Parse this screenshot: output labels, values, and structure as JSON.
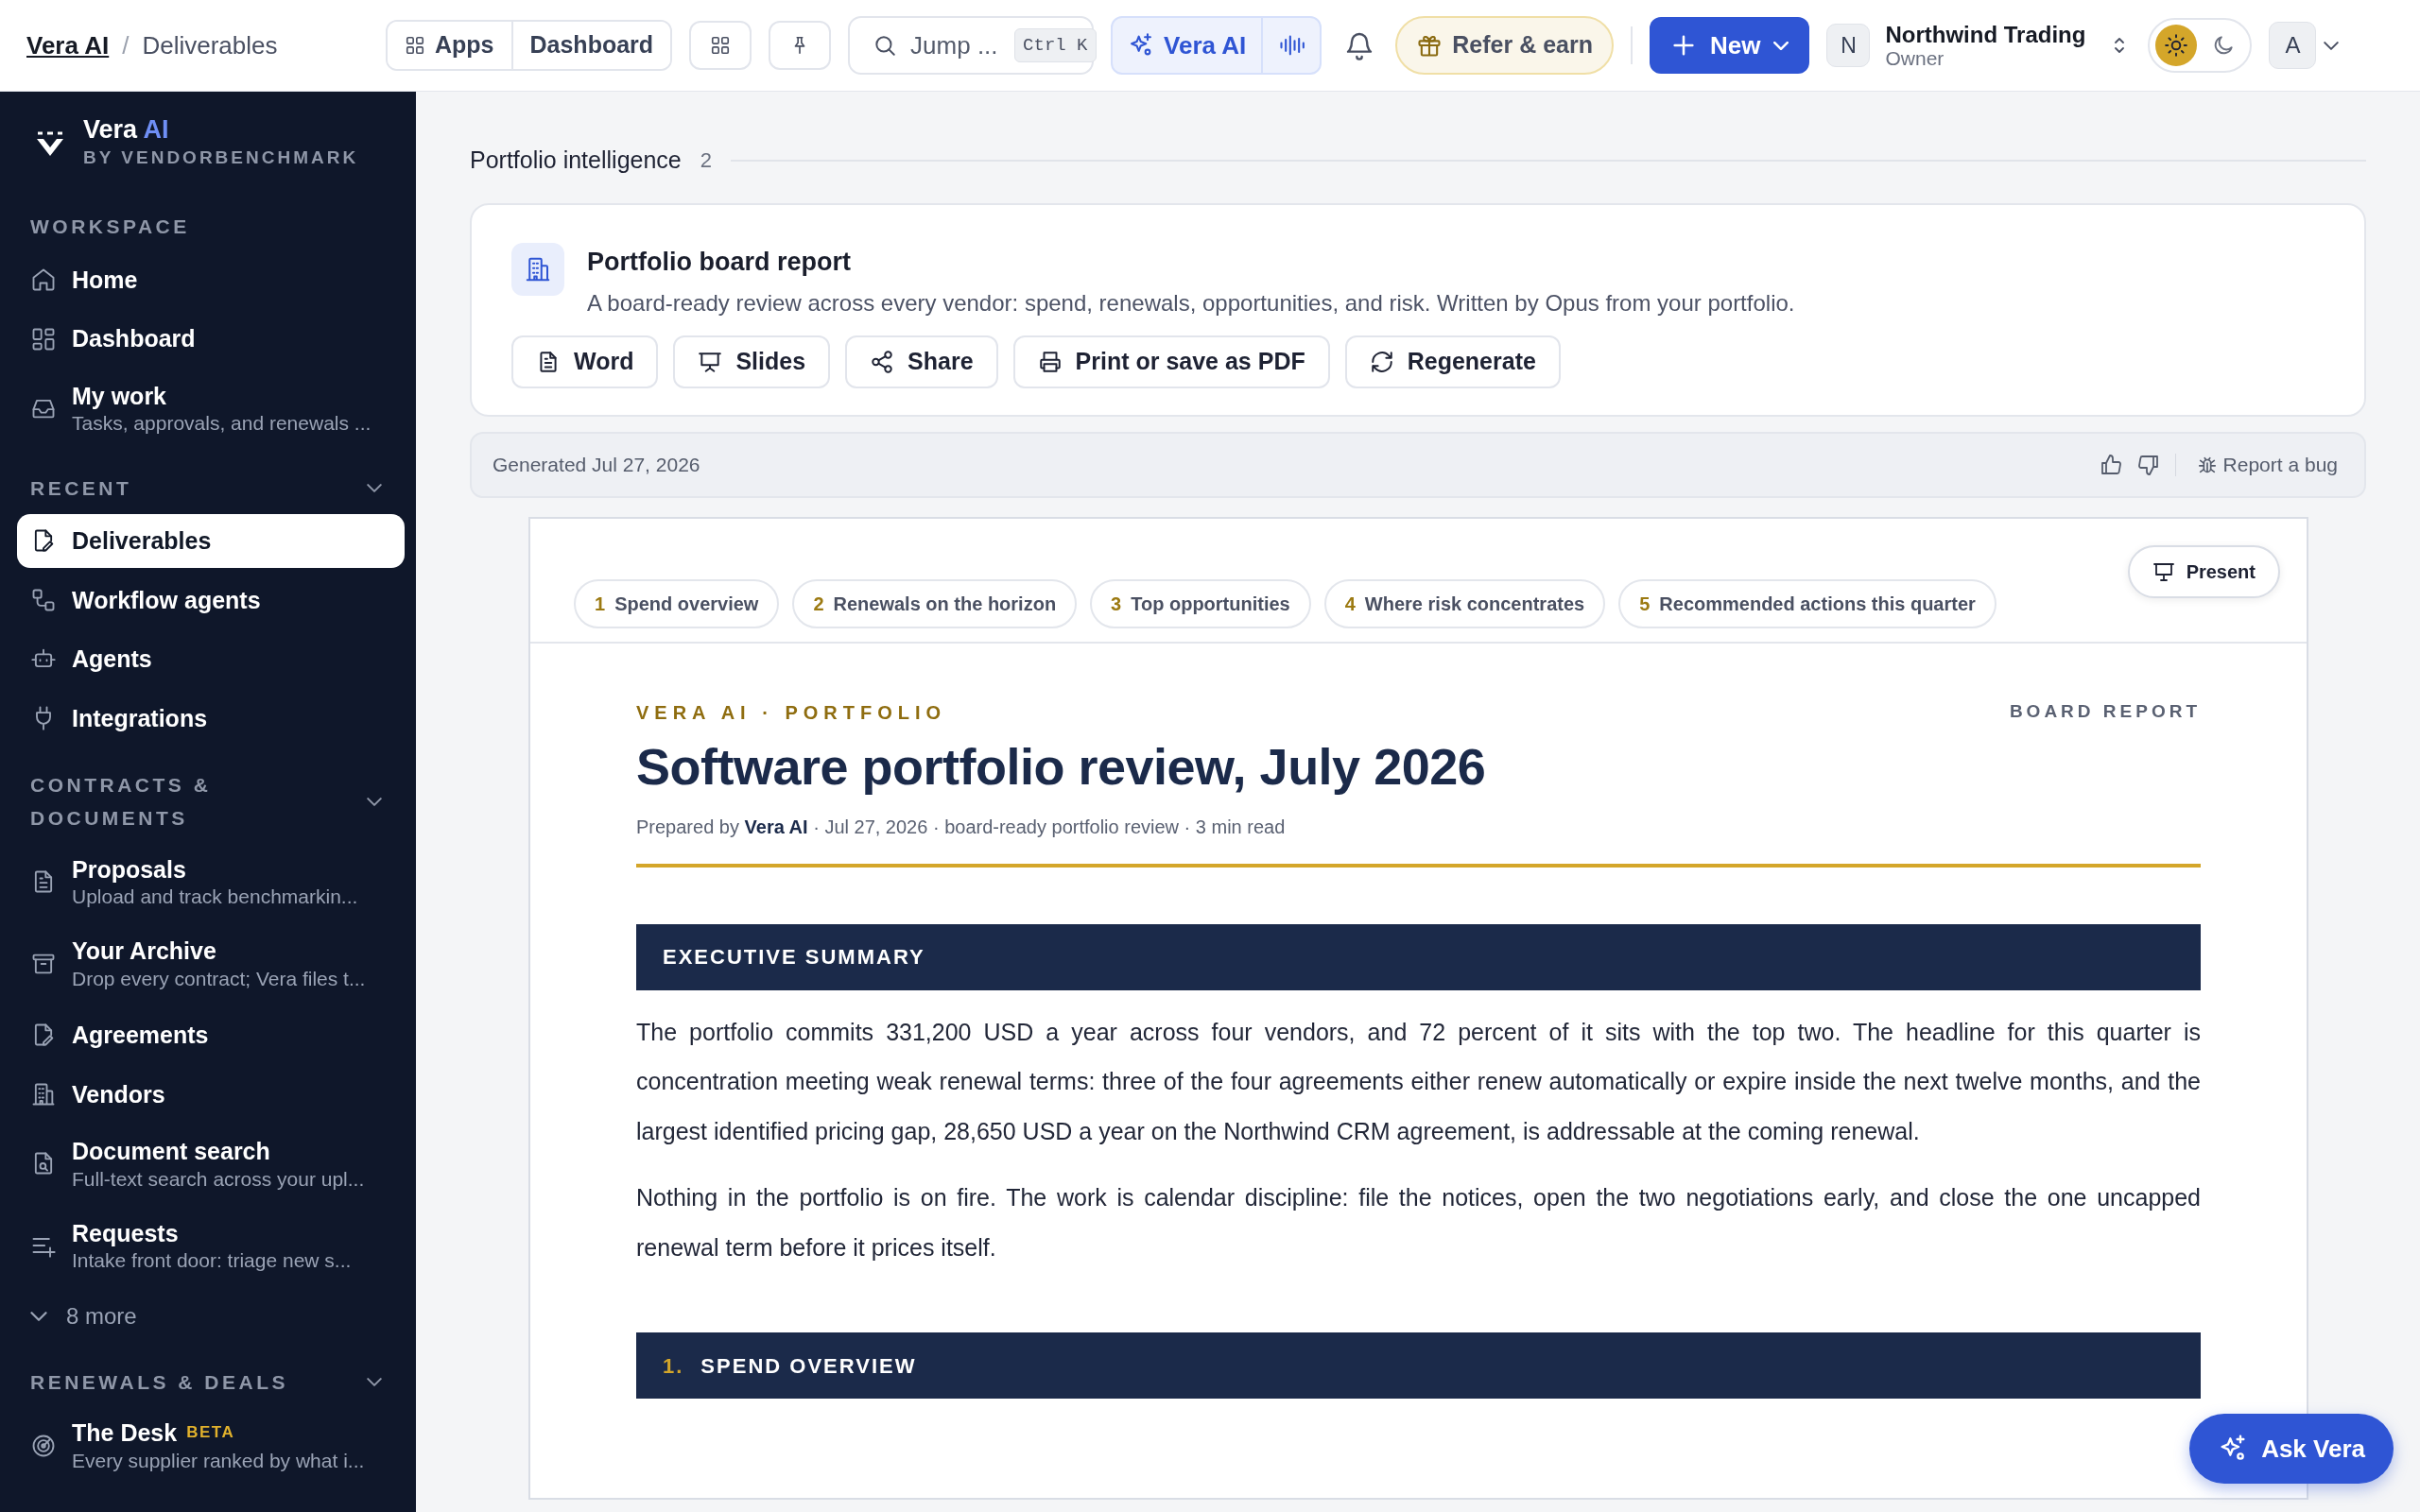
{
  "breadcrumb": [
    "Vera AI",
    "Deliverables"
  ],
  "breadcrumb_separator": "/",
  "topbar": {
    "apps": "Apps",
    "dashboard": "Dashboard",
    "search": {
      "placeholder": "Jump ...",
      "shortcut": "Ctrl K"
    },
    "assistant": "Vera AI",
    "refer": "Refer & earn",
    "new": "New",
    "org": {
      "initial": "N",
      "name": "Northwind Trading",
      "role": "Owner"
    },
    "theme": [
      {
        "selected": true
      },
      {
        "selected": false
      }
    ],
    "user_initial": "A"
  },
  "sidebar": {
    "brand": {
      "name": "Vera",
      "accent": "AI",
      "subtitle": "BY VENDORBENCHMARK"
    },
    "sections": [
      {
        "title": "WORKSPACE",
        "items": [
          {
            "label": "Home",
            "selected": false
          },
          {
            "label": "Dashboard",
            "selected": false
          },
          {
            "label": "My work",
            "sub": "Tasks, approvals, and renewals ...",
            "selected": false
          }
        ]
      },
      {
        "title": "RECENT",
        "expanded": true,
        "items": [
          {
            "label": "Deliverables",
            "selected": true
          },
          {
            "label": "Workflow agents",
            "selected": false
          },
          {
            "label": "Agents",
            "selected": false
          },
          {
            "label": "Integrations",
            "selected": false
          }
        ]
      },
      {
        "title": "CONTRACTS & DOCUMENTS",
        "expanded": true,
        "items": [
          {
            "label": "Proposals",
            "sub": "Upload and track benchmarkin...",
            "selected": false
          },
          {
            "label": "Your Archive",
            "sub": "Drop every contract; Vera files t...",
            "selected": false
          },
          {
            "label": "Agreements",
            "selected": false
          },
          {
            "label": "Vendors",
            "selected": false
          },
          {
            "label": "Document search",
            "sub": "Full-text search across your upl...",
            "selected": false
          },
          {
            "label": "Requests",
            "sub": "Intake front door: triage new s...",
            "selected": false
          }
        ],
        "more": "8 more"
      },
      {
        "title": "RENEWALS & DEALS",
        "expanded": true,
        "items": [
          {
            "label": "The Desk",
            "badge": "BETA",
            "sub": "Every supplier ranked by what i...",
            "selected": false
          }
        ]
      }
    ]
  },
  "section_header": {
    "title": "Portfolio intelligence",
    "count": "2"
  },
  "report_card": {
    "title": "Portfolio board report",
    "description": "A board-ready review across every vendor: spend, renewals, opportunities, and risk. Written by Opus from your portfolio.",
    "actions": [
      "Word",
      "Slides",
      "Share",
      "Print or save as PDF",
      "Regenerate"
    ]
  },
  "feedback_bar": {
    "generated": "Generated Jul 27, 2026",
    "report_bug": "Report a bug"
  },
  "document": {
    "present": "Present",
    "tabs": [
      {
        "number": "1",
        "label": "Spend overview"
      },
      {
        "number": "2",
        "label": "Renewals on the horizon"
      },
      {
        "number": "3",
        "label": "Top opportunities"
      },
      {
        "number": "4",
        "label": "Where risk concentrates"
      },
      {
        "number": "5",
        "label": "Recommended actions this quarter"
      }
    ],
    "kicker": "VERA AI · PORTFOLIO",
    "tag": "BOARD REPORT",
    "title": "Software portfolio review, July 2026",
    "meta": "Prepared by **Vera AI** · Jul 27, 2026 · board-ready portfolio review · 3 min read",
    "sections": [
      {
        "heading": "EXECUTIVE SUMMARY",
        "paragraphs": [
          "The portfolio commits 331,200 USD a year across four vendors, and 72 percent of it sits with the top two. The headline for this quarter is concentration meeting weak renewal terms: three of the four agreements either renew automatically or expire inside the next twelve months, and the largest identified pricing gap, 28,650 USD a year on the Northwind CRM agreement, is addressable at the coming renewal.",
          "Nothing in the portfolio is on fire. The work is calendar discipline: file the notices, open the two negotiations early, and close the one uncapped renewal term before it prices itself."
        ]
      },
      {
        "number": "1.",
        "heading": "SPEND OVERVIEW"
      }
    ]
  },
  "ask_button": "Ask Vera"
}
